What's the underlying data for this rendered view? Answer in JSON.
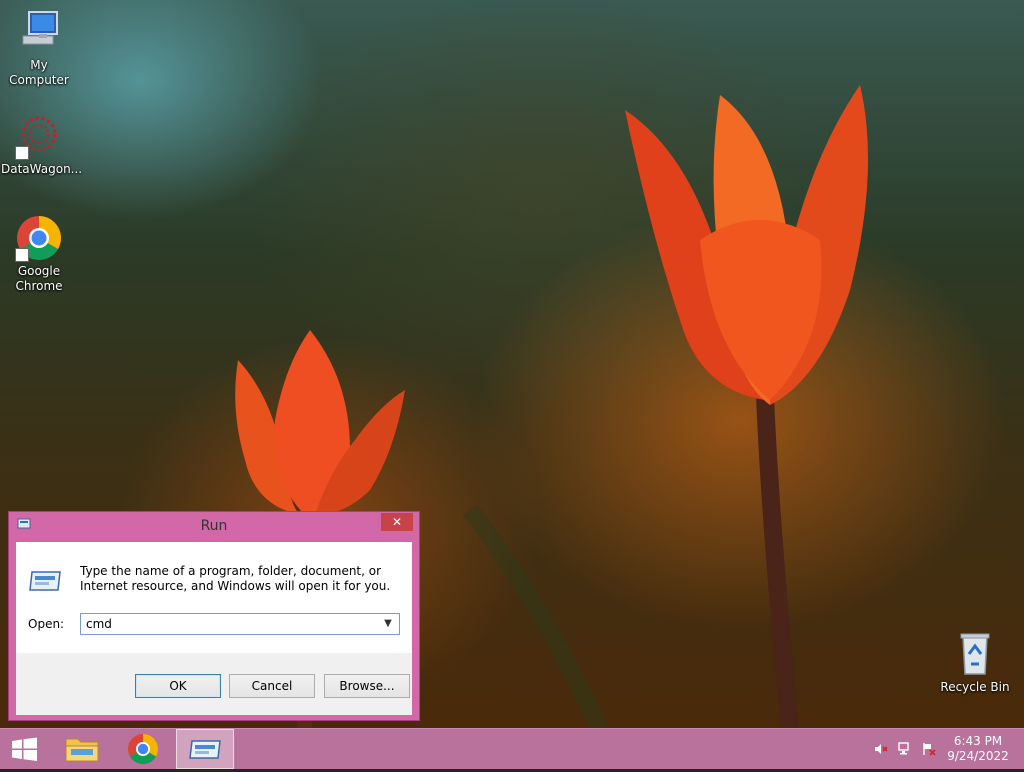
{
  "desktop": {
    "icons": [
      {
        "label": "My Computer",
        "icon": "computer-icon"
      },
      {
        "label": "DataWagon...",
        "icon": "datawagon-icon"
      },
      {
        "label": "Google\nChrome",
        "label_line1": "Google",
        "label_line2": "Chrome",
        "icon": "chrome-icon"
      },
      {
        "label": "Recycle Bin",
        "icon": "recycle-bin-icon"
      }
    ]
  },
  "run_dialog": {
    "title": "Run",
    "close_label": "✕",
    "description": "Type the name of a program, folder, document, or Internet resource, and Windows will open it for you.",
    "open_label": "Open:",
    "open_value": "cmd",
    "buttons": {
      "ok": "OK",
      "cancel": "Cancel",
      "browse": "Browse..."
    }
  },
  "taskbar": {
    "items": [
      {
        "name": "start-button",
        "icon": "windows-logo-icon"
      },
      {
        "name": "file-explorer",
        "icon": "folder-icon"
      },
      {
        "name": "google-chrome",
        "icon": "chrome-icon"
      },
      {
        "name": "run",
        "icon": "run-icon",
        "active": true
      }
    ],
    "tray_icons": [
      "speaker-muted-icon",
      "network-icon",
      "action-center-icon"
    ],
    "time": "6:43 PM",
    "date": "9/24/2022"
  },
  "colors": {
    "taskbar": "#b9729c",
    "dialog_frame": "#d368a8",
    "close_button": "#c8424a"
  }
}
